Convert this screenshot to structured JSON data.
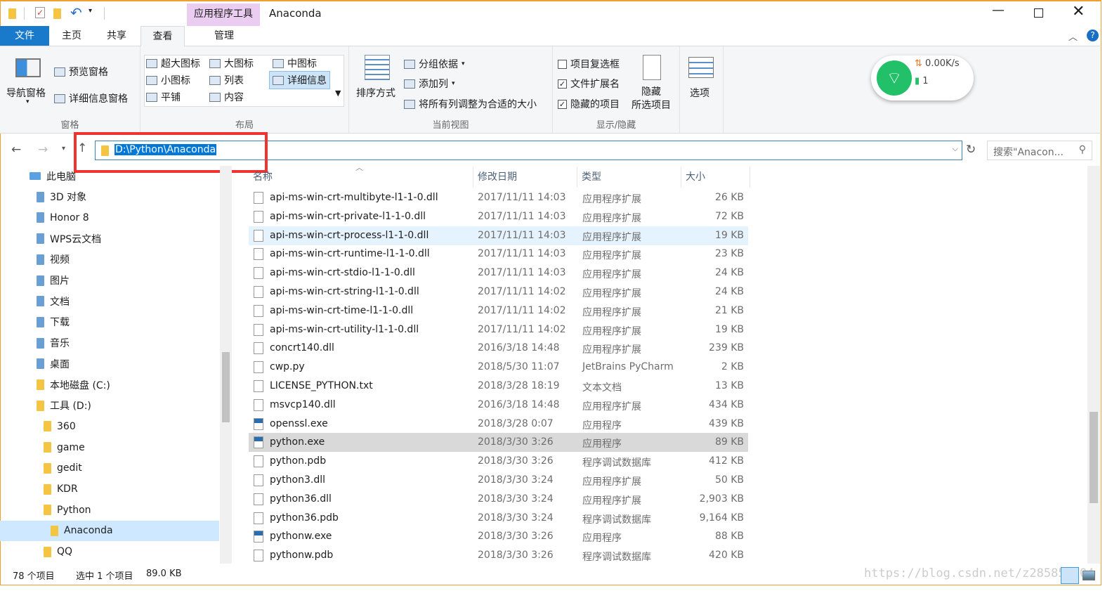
{
  "window": {
    "title": "Anaconda",
    "context_tab": "应用程序工具"
  },
  "tabs": [
    {
      "label": "文件"
    },
    {
      "label": "主页"
    },
    {
      "label": "共享"
    },
    {
      "label": "查看"
    },
    {
      "label": "管理"
    }
  ],
  "ribbon": {
    "pane": {
      "nav_pane": "导航窗格",
      "preview": "预览窗格",
      "details": "详细信息窗格",
      "label": "窗格"
    },
    "layout": {
      "items": [
        "超大图标",
        "大图标",
        "中图标",
        "小图标",
        "列表",
        "详细信息",
        "平铺",
        "内容"
      ],
      "label": "布局"
    },
    "current_view": {
      "sort": "排序方式",
      "group_by": "分组依据",
      "add_column": "添加列",
      "fit_columns": "将所有列调整为合适的大小",
      "label": "当前视图"
    },
    "show_hide": {
      "item_checkbox": "项目复选框",
      "extensions": "文件扩展名",
      "hidden_items": "隐藏的项目",
      "hide_selected_1": "隐藏",
      "hide_selected_2": "所选项目",
      "label": "显示/隐藏",
      "checks": [
        false,
        true,
        true
      ]
    },
    "options": "选项"
  },
  "widget": {
    "speed": "0.00K/s",
    "devices": "1"
  },
  "address": {
    "path": "D:\\Python\\Anaconda",
    "search_placeholder": "搜索\"Anacon..."
  },
  "nav": [
    {
      "label": "此电脑",
      "level": 0
    },
    {
      "label": "3D 对象",
      "level": 1
    },
    {
      "label": "Honor 8",
      "level": 1
    },
    {
      "label": "WPS云文档",
      "level": 1
    },
    {
      "label": "视频",
      "level": 1
    },
    {
      "label": "图片",
      "level": 1
    },
    {
      "label": "文档",
      "level": 1
    },
    {
      "label": "下载",
      "level": 1
    },
    {
      "label": "音乐",
      "level": 1
    },
    {
      "label": "桌面",
      "level": 1
    },
    {
      "label": "本地磁盘 (C:)",
      "level": 1
    },
    {
      "label": "工具 (D:)",
      "level": 1
    },
    {
      "label": "360",
      "level": 2
    },
    {
      "label": "game",
      "level": 2
    },
    {
      "label": "gedit",
      "level": 2
    },
    {
      "label": "KDR",
      "level": 2
    },
    {
      "label": "Python",
      "level": 2
    },
    {
      "label": "Anaconda",
      "level": 3,
      "selected": true
    },
    {
      "label": "QQ",
      "level": 2
    }
  ],
  "columns": [
    "名称",
    "修改日期",
    "类型",
    "大小"
  ],
  "files": [
    {
      "name": "api-ms-win-crt-multibyte-l1-1-0.dll",
      "date": "2017/11/11 14:03",
      "type": "应用程序扩展",
      "size": "26 KB"
    },
    {
      "name": "api-ms-win-crt-private-l1-1-0.dll",
      "date": "2017/11/11 14:03",
      "type": "应用程序扩展",
      "size": "72 KB"
    },
    {
      "name": "api-ms-win-crt-process-l1-1-0.dll",
      "date": "2017/11/11 14:03",
      "type": "应用程序扩展",
      "size": "19 KB",
      "hover": true
    },
    {
      "name": "api-ms-win-crt-runtime-l1-1-0.dll",
      "date": "2017/11/11 14:03",
      "type": "应用程序扩展",
      "size": "23 KB"
    },
    {
      "name": "api-ms-win-crt-stdio-l1-1-0.dll",
      "date": "2017/11/11 14:03",
      "type": "应用程序扩展",
      "size": "24 KB"
    },
    {
      "name": "api-ms-win-crt-string-l1-1-0.dll",
      "date": "2017/11/11 14:02",
      "type": "应用程序扩展",
      "size": "24 KB"
    },
    {
      "name": "api-ms-win-crt-time-l1-1-0.dll",
      "date": "2017/11/11 14:02",
      "type": "应用程序扩展",
      "size": "21 KB"
    },
    {
      "name": "api-ms-win-crt-utility-l1-1-0.dll",
      "date": "2017/11/11 14:02",
      "type": "应用程序扩展",
      "size": "19 KB"
    },
    {
      "name": "concrt140.dll",
      "date": "2016/3/18 14:48",
      "type": "应用程序扩展",
      "size": "239 KB"
    },
    {
      "name": "cwp.py",
      "date": "2018/5/30 11:07",
      "type": "JetBrains PyCharm",
      "size": "2 KB"
    },
    {
      "name": "LICENSE_PYTHON.txt",
      "date": "2018/3/28 18:19",
      "type": "文本文档",
      "size": "13 KB"
    },
    {
      "name": "msvcp140.dll",
      "date": "2016/3/18 14:48",
      "type": "应用程序扩展",
      "size": "434 KB"
    },
    {
      "name": "openssl.exe",
      "date": "2018/3/28 0:07",
      "type": "应用程序",
      "size": "439 KB"
    },
    {
      "name": "python.exe",
      "date": "2018/3/30 3:26",
      "type": "应用程序",
      "size": "89 KB",
      "selected": true
    },
    {
      "name": "python.pdb",
      "date": "2018/3/30 3:26",
      "type": "程序调试数据库",
      "size": "412 KB"
    },
    {
      "name": "python3.dll",
      "date": "2018/3/30 3:24",
      "type": "应用程序扩展",
      "size": "50 KB"
    },
    {
      "name": "python36.dll",
      "date": "2018/3/30 3:24",
      "type": "应用程序扩展",
      "size": "2,903 KB"
    },
    {
      "name": "python36.pdb",
      "date": "2018/3/30 3:24",
      "type": "程序调试数据库",
      "size": "9,164 KB"
    },
    {
      "name": "pythonw.exe",
      "date": "2018/3/30 3:26",
      "type": "应用程序",
      "size": "88 KB"
    },
    {
      "name": "pythonw.pdb",
      "date": "2018/3/30 3:26",
      "type": "程序调试数据库",
      "size": "420 KB"
    }
  ],
  "status": {
    "count": "78 个项目",
    "selected": "选中 1 个项目",
    "size": "89.0 KB"
  },
  "watermark": "https://blog.csdn.net/z285853804"
}
